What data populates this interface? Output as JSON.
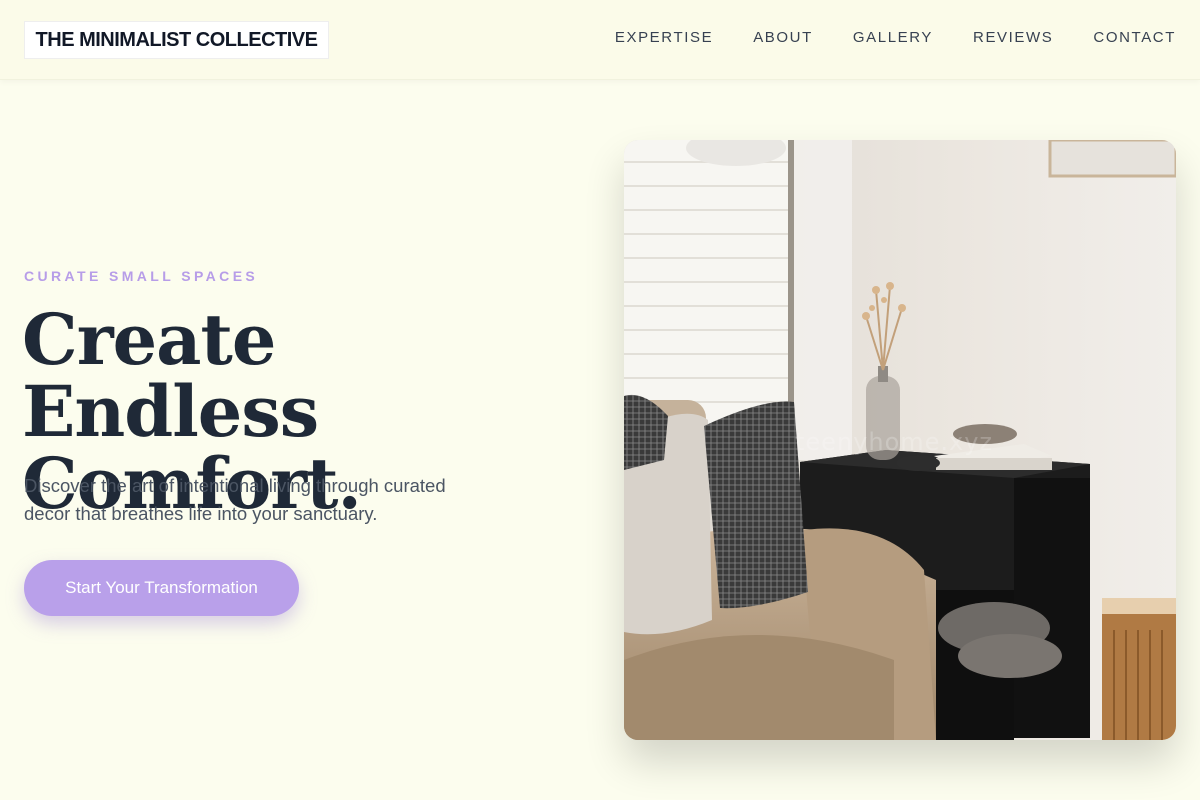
{
  "header": {
    "logo": "THE MINIMALIST COLLECTIVE",
    "nav": [
      {
        "label": "EXPERTISE"
      },
      {
        "label": "ABOUT"
      },
      {
        "label": "GALLERY"
      },
      {
        "label": "REVIEWS"
      },
      {
        "label": "CONTACT"
      }
    ]
  },
  "hero": {
    "eyebrow": "CURATE SMALL SPACES",
    "headline_line1": "Create Endless",
    "headline_line2": "Comfort.",
    "subtext": "Discover the art of intentional living through curated decor that breathes life into your sanctuary.",
    "cta_label": "Start Your Transformation",
    "image_alt": "Cozy living room corner with armchair, pillows, side table and dried flower vase",
    "watermark": "teenyhome.xyz"
  },
  "colors": {
    "background": "#fcfdee",
    "accent": "#b9a0ea",
    "eyebrow": "#b79de8",
    "heading": "#1f2937",
    "body_text": "#4b5563"
  }
}
